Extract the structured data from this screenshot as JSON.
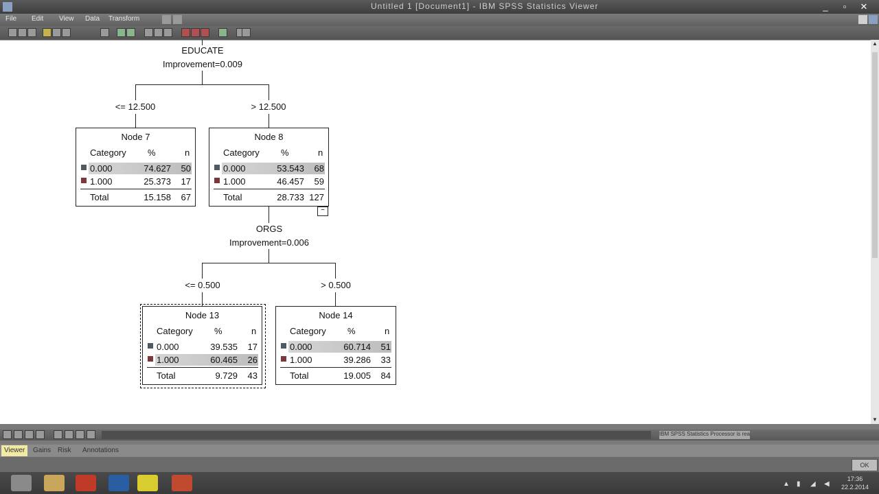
{
  "window": {
    "title": "Untitled 1 [Document1] - IBM SPSS Statistics Viewer",
    "close_glyph": "✕"
  },
  "menu": {
    "items": [
      "File",
      "Edit",
      "View",
      "Data",
      "Transform"
    ]
  },
  "tree": {
    "split1": {
      "variable": "EDUCATE",
      "improvement": "Improvement=0.009",
      "left_rule": "<= 12.500",
      "right_rule": "> 12.500"
    },
    "split2": {
      "variable": "ORGS",
      "improvement": "Improvement=0.006",
      "left_rule": "<= 0.500",
      "right_rule": "> 0.500"
    },
    "headers": {
      "category": "Category",
      "percent": "%",
      "n": "n"
    },
    "total_label": "Total",
    "nodes": [
      {
        "title": "Node 7",
        "rows": [
          {
            "cat": "0.000",
            "pct": "74.627",
            "n": "50"
          },
          {
            "cat": "1.000",
            "pct": "25.373",
            "n": "17"
          }
        ],
        "total_pct": "15.158",
        "total_n": "67",
        "highlight_row": 0
      },
      {
        "title": "Node 8",
        "rows": [
          {
            "cat": "0.000",
            "pct": "53.543",
            "n": "68"
          },
          {
            "cat": "1.000",
            "pct": "46.457",
            "n": "59"
          }
        ],
        "total_pct": "28.733",
        "total_n": "127",
        "highlight_row": 0
      },
      {
        "title": "Node 13",
        "rows": [
          {
            "cat": "0.000",
            "pct": "39.535",
            "n": "17"
          },
          {
            "cat": "1.000",
            "pct": "60.465",
            "n": "26"
          }
        ],
        "total_pct": "9.729",
        "total_n": "43",
        "highlight_row": 1
      },
      {
        "title": "Node 14",
        "rows": [
          {
            "cat": "0.000",
            "pct": "60.714",
            "n": "51"
          },
          {
            "cat": "1.000",
            "pct": "39.286",
            "n": "33"
          }
        ],
        "total_pct": "19.005",
        "total_n": "84",
        "highlight_row": 0
      }
    ],
    "collapse_glyph": "−",
    "colors": {
      "cat0": "#505a60",
      "cat1": "#7a3838",
      "line": "#222222"
    }
  },
  "statusbar": {
    "text": "IBM SPSS Statistics Processor is ready"
  },
  "tabs": [
    "Viewer",
    "Gains",
    "Risk",
    "Annotations"
  ],
  "ok_label": "OK",
  "clock": {
    "time": "17:36",
    "date": "22.2.2014"
  },
  "taskbar_icons": [
    "spss-icon",
    "file-explorer-icon",
    "firefox-icon",
    "outlook-icon",
    "warning-app-icon",
    "powerpoint-icon"
  ]
}
